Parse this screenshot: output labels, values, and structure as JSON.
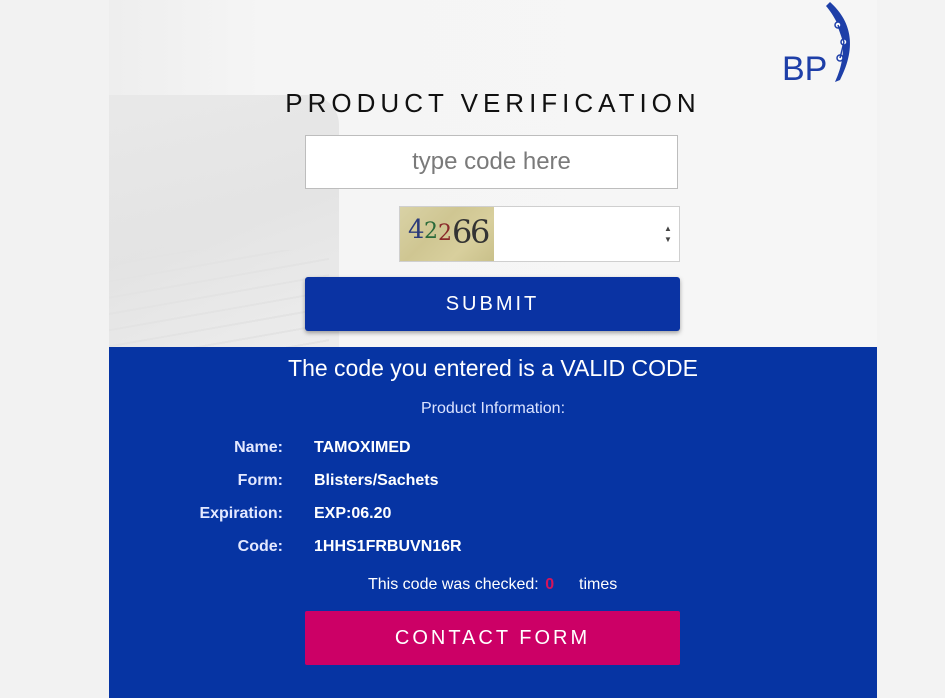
{
  "brand": {
    "logo_text": "BP"
  },
  "page": {
    "title": "PRODUCT VERIFICATION"
  },
  "form": {
    "code_placeholder": "type code here",
    "captcha_digits": [
      "4",
      "2",
      "2",
      "6",
      "6"
    ],
    "submit_label": "SUBMIT"
  },
  "result": {
    "heading": "The code you entered is a VALID CODE",
    "subheading": "Product Information:",
    "fields": [
      {
        "label": "Name:",
        "value": "TAMOXIMED"
      },
      {
        "label": "Form:",
        "value": "Blisters/Sachets"
      },
      {
        "label": "Expiration:",
        "value": "EXP:06.20"
      },
      {
        "label": "Code:",
        "value": "1HHS1FRBUVN16R"
      }
    ],
    "checked_prefix": "This code was checked:",
    "checked_count": "0",
    "checked_suffix": "times",
    "contact_label": "CONTACT FORM"
  },
  "colors": {
    "primary": "#0634a3",
    "accent": "#cc0066"
  }
}
